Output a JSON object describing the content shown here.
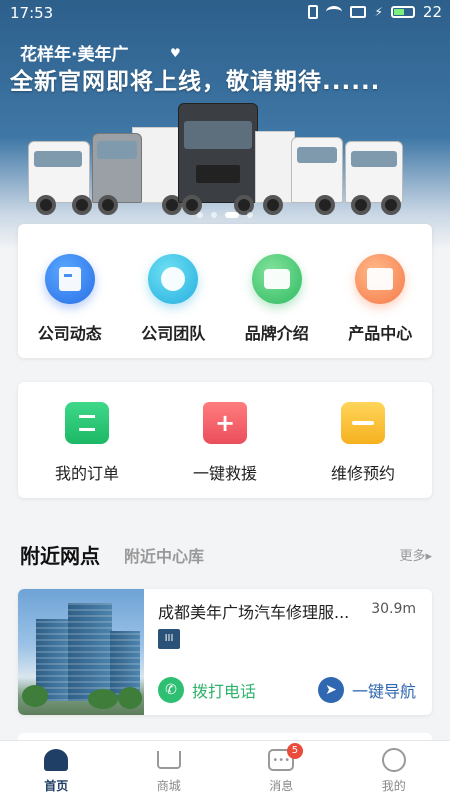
{
  "status_bar": {
    "time": "17:53",
    "battery": "22"
  },
  "banner": {
    "slogan_small": "花样年·美年广",
    "slogan_big": "全新官网即将上线，敬请期待......",
    "slide_count": 4,
    "active_slide": 1
  },
  "quick_menu": [
    {
      "label": "公司动态",
      "icon": "news-icon"
    },
    {
      "label": "公司团队",
      "icon": "team-icon"
    },
    {
      "label": "品牌介绍",
      "icon": "brand-icon"
    },
    {
      "label": "产品中心",
      "icon": "product-icon"
    }
  ],
  "services": [
    {
      "label": "我的订单",
      "icon": "order-icon"
    },
    {
      "label": "一键救援",
      "icon": "rescue-icon",
      "symbol": "+"
    },
    {
      "label": "维修预约",
      "icon": "repair-appointment-icon"
    }
  ],
  "nearby": {
    "title": "附近网点",
    "subtitle": "附近中心库",
    "more": "更多▸",
    "stores": [
      {
        "name": "成都美年广场汽车修理服...",
        "distance": "30.9m",
        "tag": "III",
        "call_label": "拨打电话",
        "nav_label": "一键导航"
      }
    ]
  },
  "tabbar": {
    "items": [
      {
        "label": "首页",
        "active": true
      },
      {
        "label": "商城",
        "active": false
      },
      {
        "label": "消息",
        "active": false,
        "badge": "5"
      },
      {
        "label": "我的",
        "active": false
      }
    ]
  },
  "colors": {
    "primary": "#1f3f66",
    "banner": "#3f77a6",
    "call_green": "#2fbf72",
    "nav_blue": "#2f68b0"
  }
}
